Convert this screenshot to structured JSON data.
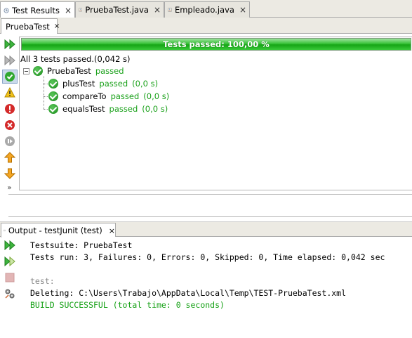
{
  "tabs": [
    {
      "label": "Test Results",
      "icon": "test-results-icon",
      "active": true
    },
    {
      "label": "PruebaTest.java",
      "icon": "java-file-icon",
      "active": false
    },
    {
      "label": "Empleado.java",
      "icon": "java-file-icon",
      "active": false
    }
  ],
  "close_glyph": "×",
  "subtab": {
    "label": "PruebaTest"
  },
  "progress": {
    "text": "Tests passed: 100,00 %",
    "fraction": 1.0,
    "color": "#2fbf2f"
  },
  "summary": "All 3 tests passed.(0,042 s)",
  "suite": {
    "name": "PruebaTest",
    "status": "passed"
  },
  "tests": [
    {
      "name": "plusTest",
      "status": "passed",
      "time": "(0,0 s)"
    },
    {
      "name": "compareTo",
      "status": "passed",
      "time": "(0,0 s)"
    },
    {
      "name": "equalsTest",
      "status": "passed",
      "time": "(0,0 s)"
    }
  ],
  "left_toolbar": [
    "rerun-icon",
    "rerun-failed-icon",
    "show-passed-icon",
    "show-warnings-icon",
    "show-failures-icon",
    "show-errors-icon",
    "show-aborted-icon",
    "previous-failure-icon",
    "next-failure-icon"
  ],
  "more_glyph": "»",
  "output": {
    "tab_label": "Output - testJunit (test)",
    "lines": [
      {
        "text": "Testsuite: PruebaTest",
        "style": "normal"
      },
      {
        "text": "Tests run: 3, Failures: 0, Errors: 0, Skipped: 0, Time elapsed: 0,042 sec",
        "style": "normal"
      },
      {
        "text": "",
        "style": "normal"
      },
      {
        "text": "test:",
        "style": "gray"
      },
      {
        "text": "Deleting: C:\\Users\\Trabajo\\AppData\\Local\\Temp\\TEST-PruebaTest.xml",
        "style": "normal"
      },
      {
        "text": "BUILD SUCCESSFUL (total time: 0 seconds)",
        "style": "green"
      }
    ]
  },
  "colors": {
    "pass_green": "#1aa11a",
    "tab_bg": "#eceae3"
  }
}
